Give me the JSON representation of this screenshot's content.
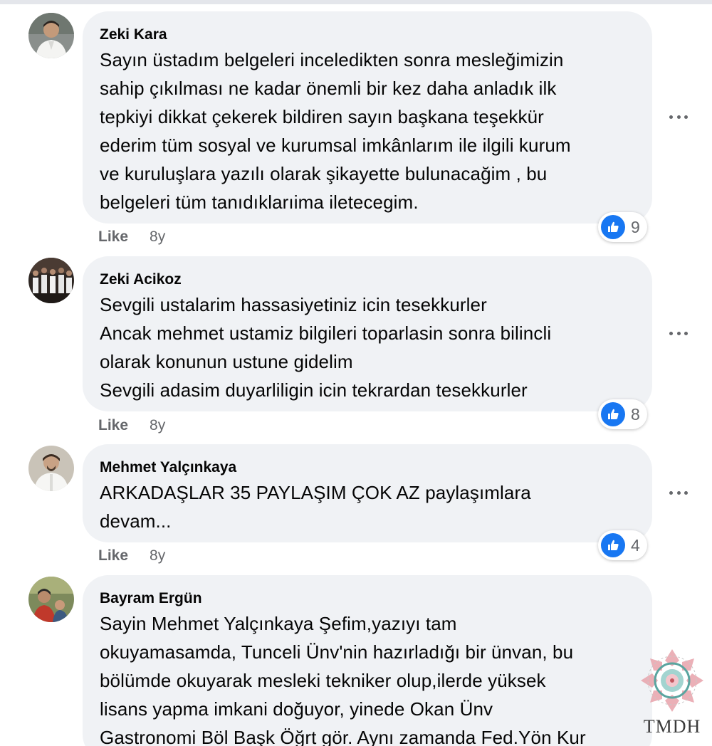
{
  "comments": [
    {
      "author": "Zeki Kara",
      "text": "Sayın üstadım belgeleri inceledikten sonra mesleğimizin\nsahip çıkılması ne kadar önemli bir kez daha anladık ilk\ntepkiyi dikkat çekerek bildiren sayın başkana teşekkür\nederim tüm sosyal ve kurumsal imkânlarım ile ilgili kurum\nve kuruluşlara yazılı olarak şikayette bulunacağim , bu\nbelgeleri tüm tanıdıklarıima iletecegim.",
      "like_label": "Like",
      "time": "8y",
      "reaction_count": "9"
    },
    {
      "author": "Zeki Acikoz",
      "text": "Sevgili ustalarim hassasiyetiniz icin tesekkurler\nAncak mehmet ustamiz bilgileri toparlasin sonra bilincli\nolarak konunun ustune gidelim\nSevgili adasim duyarliligin icin tekrardan tesekkurler",
      "like_label": "Like",
      "time": "8y",
      "reaction_count": "8"
    },
    {
      "author": "Mehmet Yalçınkaya",
      "text": "ARKADAŞLAR 35 PAYLAŞIM ÇOK AZ paylaşımlara\ndevam...",
      "like_label": "Like",
      "time": "8y",
      "reaction_count": "4"
    },
    {
      "author": "Bayram Ergün",
      "text": "Sayin Mehmet Yalçınkaya Şefim,yazıyı tam\nokuyamasamda, Tunceli Ünv'nin hazırladığı bir ünvan, bu\nbölümde okuyarak mesleki tekniker olup,ilerde yüksek\nlisans yapma imkani doğuyor, yinede Okan Ünv\nGastronomi Böl Başk Öğrt gör. Aynı zamanda Fed.Yön Kur"
    }
  ],
  "watermark": {
    "text": "TMDH"
  },
  "colors": {
    "bubble": "#f0f2f5",
    "like_blue": "#1877f2",
    "meta_gray": "#65676b",
    "text": "#050505"
  },
  "icons": {
    "more": "more-horizontal-icon",
    "reaction": "thumbs-up-icon"
  }
}
